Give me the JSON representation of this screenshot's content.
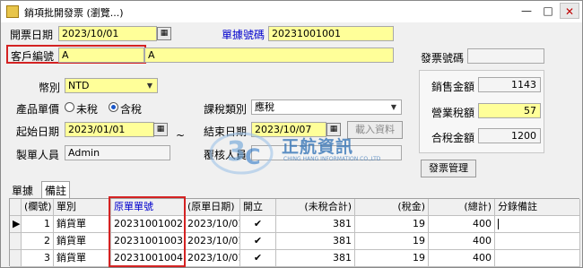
{
  "window": {
    "title": "銷項批開發票 (瀏覽...)"
  },
  "header": {
    "invoice_date_label": "開票日期",
    "invoice_date_value": "2023/10/01",
    "doc_no_label": "單據號碼",
    "doc_no_value": "20231001001",
    "customer_label": "客戶編號",
    "customer_code": "A",
    "customer_name": "A",
    "invoice_no_label": "發票號碼",
    "invoice_no_value": ""
  },
  "filters": {
    "currency_label": "幣別",
    "currency_value": "NTD",
    "unit_price_label": "產品單價",
    "radio_untaxed": "未稅",
    "radio_taxed": "含稅",
    "selected_radio": "含稅",
    "tax_type_label": "課稅類別",
    "tax_type_value": "應稅",
    "start_date_label": "起始日期",
    "start_date_value": "2023/01/01",
    "tilde": "~",
    "end_date_label": "結束日期",
    "end_date_value": "2023/10/07",
    "load_button": "載入資料",
    "creator_label": "製單人員",
    "creator_value": "Admin",
    "reviewer_label": "覆核人員",
    "reviewer_value": ""
  },
  "totals": {
    "sales_amount_label": "銷售金額",
    "sales_amount_value": "1143",
    "tax_amount_label": "營業稅額",
    "tax_amount_value": "57",
    "total_amount_label": "合稅金額",
    "total_amount_value": "1200",
    "invoice_mgmt_button": "發票管理"
  },
  "logo": {
    "text": "正航資訊",
    "subtext": "CHING HANG INFORMATION CO.,LTD"
  },
  "tabs": [
    "單據",
    "備註"
  ],
  "grid": {
    "columns": [
      "(欄號)",
      "單別",
      "原單單號",
      "(原單日期)",
      "開立",
      "(未稅合計)",
      "(稅金)",
      "(總計)",
      "分錄備註"
    ],
    "rows": [
      {
        "num": "1",
        "type": "銷貨單",
        "orig_no": "20231001002",
        "orig_date": "2023/10/01",
        "issued": true,
        "untaxed": "381",
        "tax": "19",
        "total": "400",
        "note": ""
      },
      {
        "num": "2",
        "type": "銷貨單",
        "orig_no": "20231001003",
        "orig_date": "2023/10/01",
        "issued": true,
        "untaxed": "381",
        "tax": "19",
        "total": "400",
        "note": ""
      },
      {
        "num": "3",
        "type": "銷貨單",
        "orig_no": "20231001004",
        "orig_date": "2023/10/01",
        "issued": true,
        "untaxed": "381",
        "tax": "19",
        "total": "400",
        "note": ""
      }
    ]
  },
  "colors": {
    "highlight_yellow": "#ffff99",
    "label_blue": "#0000cc",
    "annotation_red": "#d42222"
  }
}
